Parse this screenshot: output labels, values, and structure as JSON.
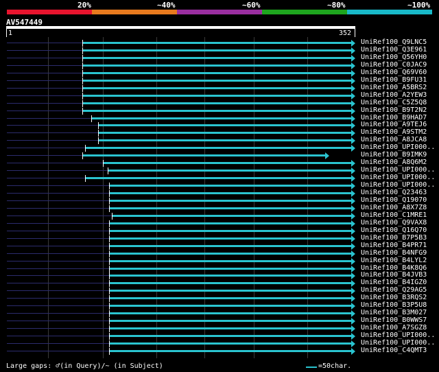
{
  "scale": {
    "labels": [
      "20%",
      "~40%",
      "~60%",
      "~80%",
      "~100%"
    ],
    "colors": [
      "#e8142e",
      "#e87a1e",
      "#9a2fa0",
      "#1ea51e",
      "#19b9c9"
    ]
  },
  "query": {
    "name": "AV547449",
    "start": "1",
    "end": "352"
  },
  "hits": [
    {
      "name": "UniRef100_Q9LNC5",
      "start": 77,
      "end": 352
    },
    {
      "name": "UniRef100_Q3E961",
      "start": 77,
      "end": 352
    },
    {
      "name": "UniRef100_Q56YH0",
      "start": 77,
      "end": 352
    },
    {
      "name": "UniRef100_C0JAC9",
      "start": 77,
      "end": 352
    },
    {
      "name": "UniRef100_Q69V60",
      "start": 77,
      "end": 352
    },
    {
      "name": "UniRef100_B9FU31",
      "start": 77,
      "end": 352
    },
    {
      "name": "UniRef100_A5BRS2",
      "start": 77,
      "end": 352
    },
    {
      "name": "UniRef100_A2YEW3",
      "start": 77,
      "end": 352
    },
    {
      "name": "UniRef100_C5Z5Q8",
      "start": 77,
      "end": 352
    },
    {
      "name": "UniRef100_B9T2N2",
      "start": 77,
      "end": 352
    },
    {
      "name": "UniRef100_B9HAD7",
      "start": 86,
      "end": 352
    },
    {
      "name": "UniRef100_A9TEJ6",
      "start": 93,
      "end": 352
    },
    {
      "name": "UniRef100_A9STM2",
      "start": 93,
      "end": 352
    },
    {
      "name": "UniRef100_A8JCA8",
      "start": 93,
      "end": 352
    },
    {
      "name": "UniRef100_UPI000..",
      "start": 80,
      "end": 352
    },
    {
      "name": "UniRef100_B9IMK9",
      "start": 77,
      "end": 326
    },
    {
      "name": "UniRef100_A8Q6M2",
      "start": 98,
      "end": 352
    },
    {
      "name": "UniRef100_UPI000..",
      "start": 103,
      "end": 352
    },
    {
      "name": "UniRef100_UPI000..",
      "start": 80,
      "end": 352
    },
    {
      "name": "UniRef100_UPI000..",
      "start": 104,
      "end": 352
    },
    {
      "name": "UniRef100_Q23463",
      "start": 104,
      "end": 352
    },
    {
      "name": "UniRef100_Q19070",
      "start": 104,
      "end": 352
    },
    {
      "name": "UniRef100_A8X7Z8",
      "start": 104,
      "end": 352
    },
    {
      "name": "UniRef100_C1MRE1",
      "start": 107,
      "end": 352
    },
    {
      "name": "UniRef100_Q9VAX8",
      "start": 104,
      "end": 352
    },
    {
      "name": "UniRef100_Q16Q70",
      "start": 104,
      "end": 352
    },
    {
      "name": "UniRef100_B7P5B3",
      "start": 104,
      "end": 352
    },
    {
      "name": "UniRef100_B4PR71",
      "start": 104,
      "end": 352
    },
    {
      "name": "UniRef100_B4NFG9",
      "start": 104,
      "end": 352
    },
    {
      "name": "UniRef100_B4LYL2",
      "start": 104,
      "end": 352
    },
    {
      "name": "UniRef100_B4K8Q6",
      "start": 104,
      "end": 352
    },
    {
      "name": "UniRef100_B4JVB3",
      "start": 104,
      "end": 352
    },
    {
      "name": "UniRef100_B4IGZ0",
      "start": 104,
      "end": 352
    },
    {
      "name": "UniRef100_Q29AG5",
      "start": 104,
      "end": 352
    },
    {
      "name": "UniRef100_B3RQS2",
      "start": 104,
      "end": 352
    },
    {
      "name": "UniRef100_B3P5U8",
      "start": 104,
      "end": 352
    },
    {
      "name": "UniRef100_B3M027",
      "start": 104,
      "end": 352
    },
    {
      "name": "UniRef100_B0WWS7",
      "start": 104,
      "end": 352
    },
    {
      "name": "UniRef100_A7SGZ8",
      "start": 104,
      "end": 352
    },
    {
      "name": "UniRef100_UPI000..",
      "start": 104,
      "end": 352
    },
    {
      "name": "UniRef100_UPI000..",
      "start": 104,
      "end": 352
    },
    {
      "name": "UniRef100_C4QMT3",
      "start": 104,
      "end": 352
    }
  ],
  "footer": {
    "gaps_text": "Large gaps: ♂(in Query)/~ (in Subject)",
    "legend_text": "=50char."
  }
}
